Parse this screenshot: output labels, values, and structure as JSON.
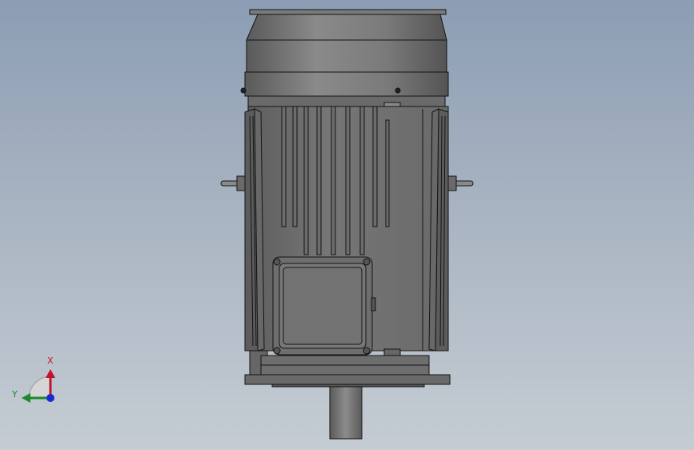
{
  "viewport": {
    "model_name": "electric-motor"
  },
  "triad": {
    "x_label": "X",
    "y_label": "Y",
    "colors": {
      "x": "#c0142a",
      "y": "#1a8a2a",
      "z": "#1a2ad0"
    }
  },
  "colors": {
    "background_top": "#8c9db4",
    "background_bottom": "#c5ccd3",
    "body": "#6e6e6e",
    "edge": "#141414"
  }
}
